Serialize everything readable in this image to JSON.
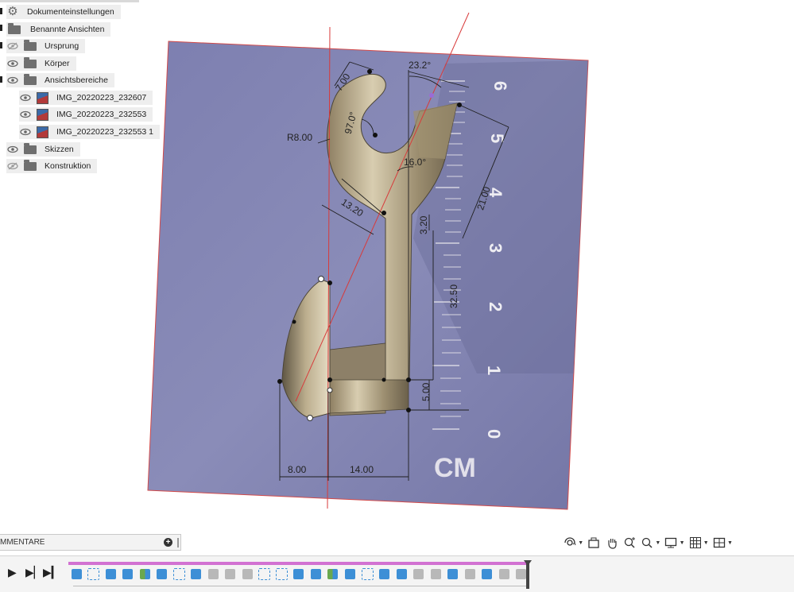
{
  "browser": {
    "items": [
      {
        "label": "Dokumenteinstellungen",
        "icon": "gear-icon",
        "visible_icon": "none"
      },
      {
        "label": "Benannte Ansichten",
        "icon": "folder-icon",
        "visible_icon": "none"
      },
      {
        "label": "Ursprung",
        "icon": "folder-icon",
        "visible_icon": "eye-hidden-icon"
      },
      {
        "label": "Körper",
        "icon": "folder-icon",
        "visible_icon": "eye-icon"
      },
      {
        "label": "Ansichtsbereiche",
        "icon": "folder-icon",
        "visible_icon": "eye-icon"
      },
      {
        "label": "IMG_20220223_232607",
        "icon": "canvas-image-icon",
        "visible_icon": "eye-icon"
      },
      {
        "label": "IMG_20220223_232553",
        "icon": "canvas-image-icon",
        "visible_icon": "eye-icon"
      },
      {
        "label": "IMG_20220223_232553 1",
        "icon": "canvas-image-icon",
        "visible_icon": "eye-icon"
      },
      {
        "label": "Skizzen",
        "icon": "folder-icon",
        "visible_icon": "eye-icon"
      },
      {
        "label": "Konstruktion",
        "icon": "folder-icon",
        "visible_icon": "eye-hidden-icon"
      }
    ]
  },
  "viewport": {
    "dimensions": {
      "d1": "7.00",
      "d2": "97.0°",
      "r1": "R8.00",
      "d3": "23.2°",
      "d4": "16.0°",
      "d5": "13.20",
      "d6": "21.00",
      "d7": "3.20",
      "d8": "32.50",
      "d9": "5.00",
      "d10": "8.00",
      "d11": "14.00"
    },
    "ruler": {
      "numbers": [
        "6",
        "5",
        "4",
        "3",
        "2",
        "1",
        "0"
      ],
      "unit": "CM"
    }
  },
  "comments": {
    "label": "MMENTARE",
    "add_icon": "plus-circle-icon"
  },
  "navigation_toolbar": [
    "orbit-icon",
    "look-at-icon",
    "pan-icon",
    "zoom-window-icon",
    "zoom-icon",
    "display-settings-icon",
    "grid-icon",
    "viewports-icon"
  ],
  "timeline": {
    "controls": [
      "play-icon",
      "step-forward-icon",
      "go-to-end-icon"
    ],
    "colors": {
      "track": "#d272d2",
      "blue": "#3d8fd6",
      "gray": "#b8b8b8",
      "green": "#6aa84f"
    }
  }
}
